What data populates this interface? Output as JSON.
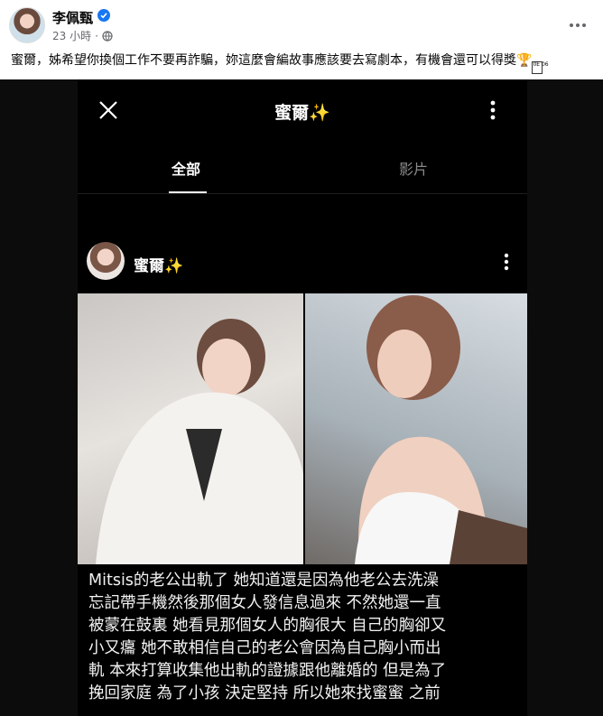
{
  "post": {
    "author": "李佩甄",
    "time": "23 小時",
    "caption": "蜜爾，姊希望你換個工作不要再詐騙，妳這麼會編故事應該要去寫劇本，有機會還可以得獎",
    "caption_box_glyph": "0E 06"
  },
  "screenshot": {
    "title": "蜜爾",
    "tabs": [
      "全部",
      "影片"
    ],
    "post_author": "蜜爾",
    "story_lines": [
      "Mitsis的老公出軌了 她知道還是因為他老公去洗澡",
      "忘記帶手機然後那個女人發信息過來 不然她還一直",
      "被蒙在鼓裏 她看見那個女人的胸很大 自己的胸卻又",
      "小又癟 她不敢相信自己的老公會因為自己胸小而出",
      "軌 本來打算收集他出軌的證據跟他離婚的 但是為了",
      "挽回家庭 為了小孩 決定堅持 所以她來找蜜蜜 之前"
    ]
  },
  "colors": {
    "verified": "#1877f2",
    "meta_gray": "#65676b",
    "dark_bg": "#000000",
    "sparkle": "#f5d04a"
  }
}
